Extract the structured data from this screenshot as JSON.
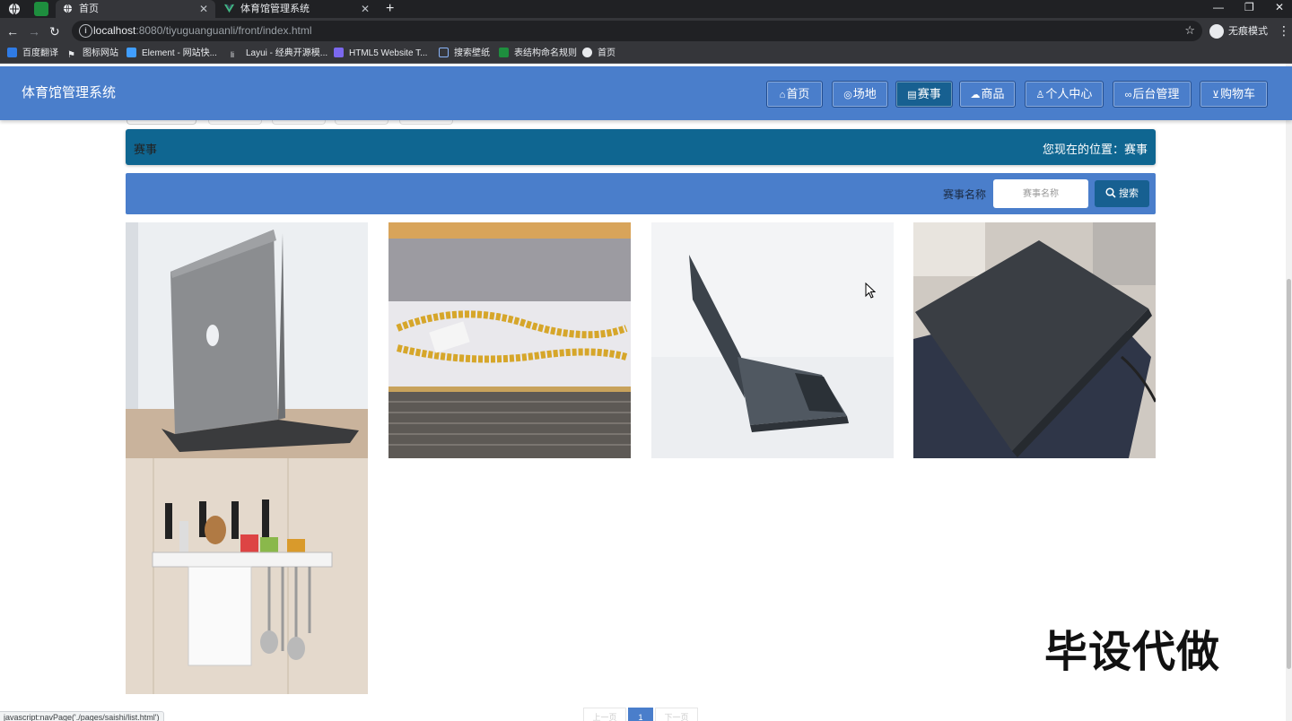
{
  "browser": {
    "tabs": [
      {
        "title": "首页",
        "active": true
      },
      {
        "title": "体育馆管理系统",
        "active": false
      }
    ],
    "address": {
      "host": "localhost",
      "rest": ":8080/tiyuguanguanli/front/index.html"
    },
    "incognito_label": "无痕模式",
    "bookmarks": [
      "百度翻译",
      "图标网站",
      "Element - 网站快...",
      "Layui - 经典开源模...",
      "HTML5 Website T...",
      "搜索壁纸",
      "表结构命名规则",
      "首页"
    ]
  },
  "site": {
    "title": "体育馆管理系统",
    "nav": [
      {
        "label": "首页",
        "icon": "home-icon"
      },
      {
        "label": "场地",
        "icon": "location-icon"
      },
      {
        "label": "赛事",
        "icon": "calendar-icon",
        "active": true
      },
      {
        "label": "商品",
        "icon": "cloud-icon"
      },
      {
        "label": "个人中心",
        "icon": "user-icon"
      },
      {
        "label": "后台管理",
        "icon": "link-icon"
      },
      {
        "label": "购物车",
        "icon": "cart-icon"
      }
    ]
  },
  "breadcrumb": {
    "section": "赛事",
    "location_prefix": "您现在的位置：",
    "location": "赛事"
  },
  "search": {
    "label": "赛事名称",
    "placeholder": "赛事名称",
    "button": "搜索"
  },
  "products": [
    {
      "image": "laptop-back-photo"
    },
    {
      "image": "gold-chain-photo"
    },
    {
      "image": "laptop-side-photo"
    },
    {
      "image": "laptop-dark-photo"
    },
    {
      "image": "kitchen-rack-photo"
    }
  ],
  "pagination": {
    "prev": "上一页",
    "current": "1",
    "next": "下一页"
  },
  "status_url": "javascript:navPage('./pages/saishi/list.html')",
  "watermark": "毕设代做",
  "colors": {
    "header": "#4a7ecb",
    "active": "#176091",
    "crumb": "#0f6691",
    "chrome": "#35363a"
  }
}
